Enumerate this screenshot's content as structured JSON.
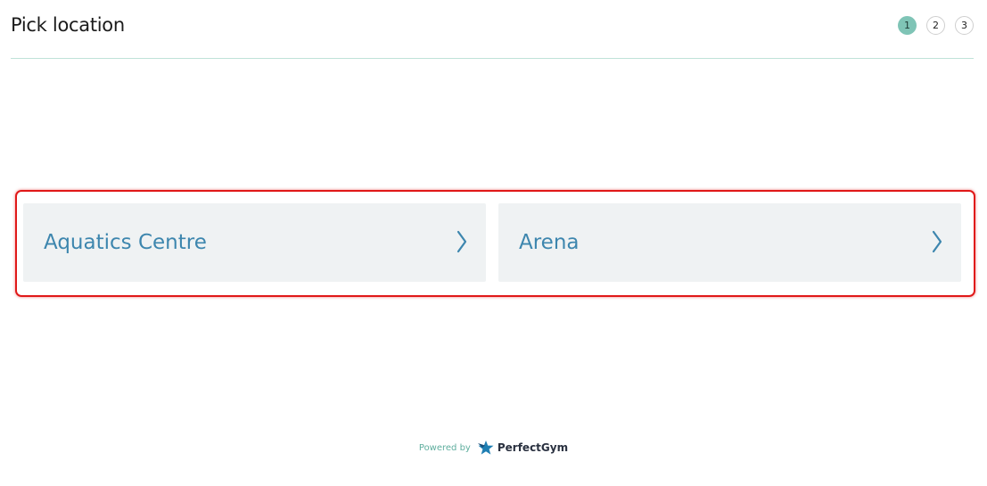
{
  "header": {
    "title": "Pick location",
    "steps": [
      {
        "label": "1",
        "active": true
      },
      {
        "label": "2",
        "active": false
      },
      {
        "label": "3",
        "active": false
      }
    ]
  },
  "locations": [
    {
      "label": "Aquatics Centre",
      "icon": "chevron-right-icon"
    },
    {
      "label": "Arena",
      "icon": "chevron-right-icon"
    }
  ],
  "footer": {
    "powered_by": "Powered by",
    "brand": "PerfectGym",
    "brand_icon": "perfectgym-logo-icon"
  },
  "colors": {
    "accent": "#7fc4b6",
    "link": "#3d86ae",
    "card_bg": "#eff2f3",
    "highlight": "#e01818"
  }
}
